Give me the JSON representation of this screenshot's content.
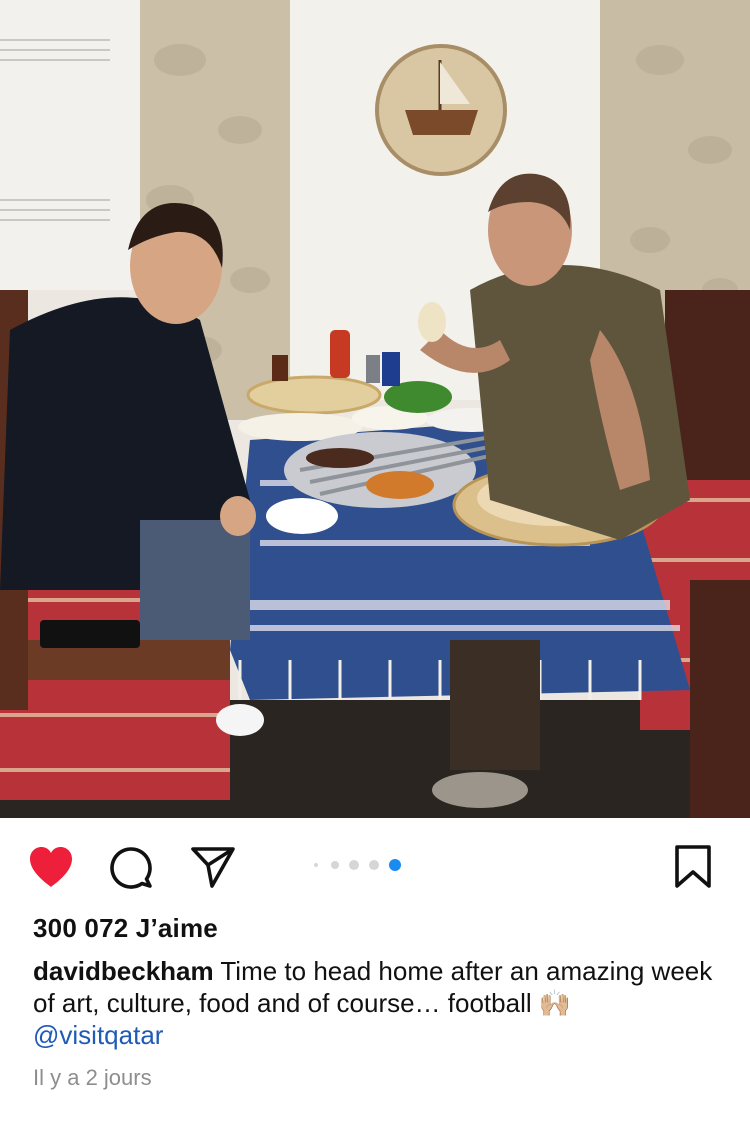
{
  "post": {
    "photo_alt": "",
    "carousel": {
      "count": 5,
      "active_index": 4
    },
    "actions": {
      "like_icon": "heart-filled-icon",
      "comment_icon": "comment-icon",
      "share_icon": "paper-plane-icon",
      "save_icon": "bookmark-icon"
    },
    "likes_text": "300 072 J’aime",
    "caption": {
      "username": "davidbeckham",
      "text": " Time to head home after an amazing week of art, culture, food and of course… football ",
      "emoji": "🙌🏼",
      "mention": "@visitqatar"
    },
    "timestamp": "Il y a 2 jours"
  },
  "colors": {
    "like_red": "#ed1f3a",
    "mention_blue": "#1f5bb6",
    "active_dot": "#1a8cf0",
    "inactive_dot": "#d6d6d6",
    "timestamp_gray": "#8e8e8e"
  }
}
